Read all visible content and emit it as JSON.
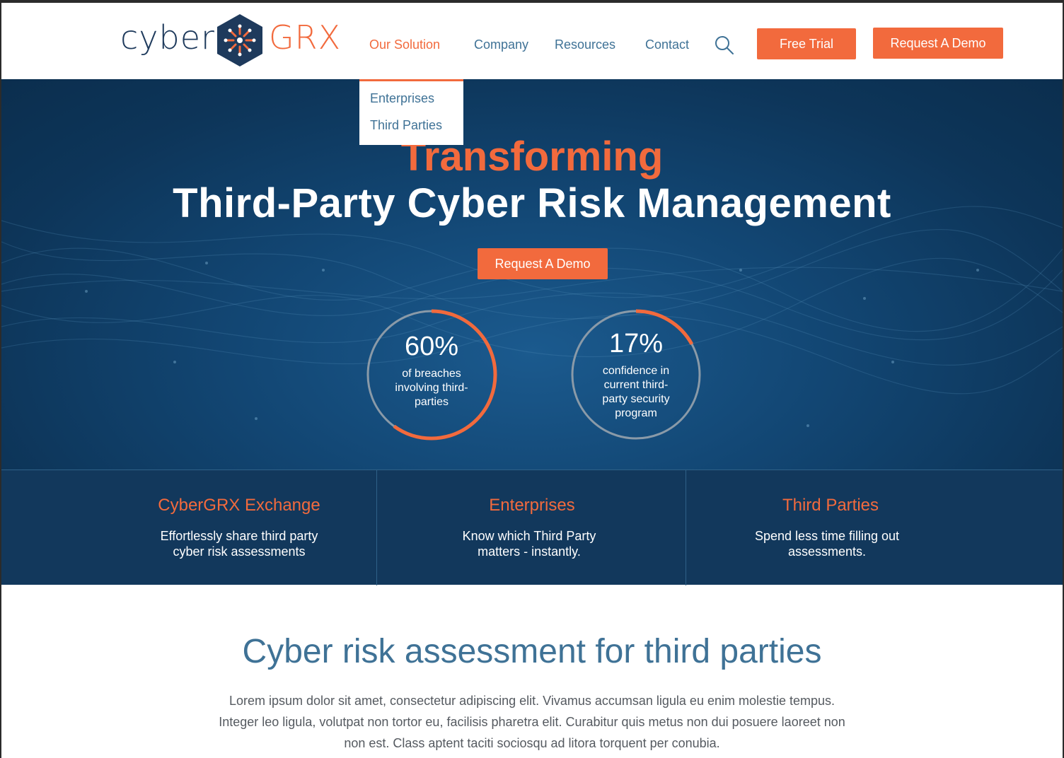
{
  "brand": {
    "logo_left": "cyber",
    "logo_right": "GRX",
    "primary_color": "#1e3a5c",
    "accent_color": "#f26a3d",
    "link_color": "#3f7296"
  },
  "nav": {
    "items": [
      {
        "label": "Our Solution",
        "active": true
      },
      {
        "label": "Company"
      },
      {
        "label": "Resources"
      },
      {
        "label": "Contact"
      }
    ],
    "search_icon": "search-icon",
    "free_trial": "Free Trial",
    "request_demo": "Request A Demo"
  },
  "dropdown": {
    "items": [
      "Enterprises",
      "Third Parties"
    ]
  },
  "hero": {
    "title_line1": "Transforming",
    "title_line2": "Third-Party Cyber Risk Management",
    "cta": "Request A Demo",
    "stats": [
      {
        "value": "60%",
        "description": "of breaches involving third-parties",
        "fraction": 0.6
      },
      {
        "value": "17%",
        "description": "confidence in current third-party security program",
        "fraction": 0.17
      }
    ]
  },
  "features": [
    {
      "title": "CyberGRX Exchange",
      "description": "Effortlessly share third party cyber risk assessments"
    },
    {
      "title": "Enterprises",
      "description": "Know which Third Party matters - instantly."
    },
    {
      "title": "Third Parties",
      "description": "Spend less time filling out assessments."
    }
  ],
  "section": {
    "title": "Cyber risk assessment for third parties",
    "body": "Lorem ipsum dolor sit amet, consectetur adipiscing elit. Vivamus accumsan ligula eu enim molestie tempus. Integer leo ligula, volutpat non tortor eu, facilisis pharetra elit. Curabitur quis metus non dui posuere laoreet non non est. Class aptent taciti sociosqu ad litora torquent per conubia."
  }
}
